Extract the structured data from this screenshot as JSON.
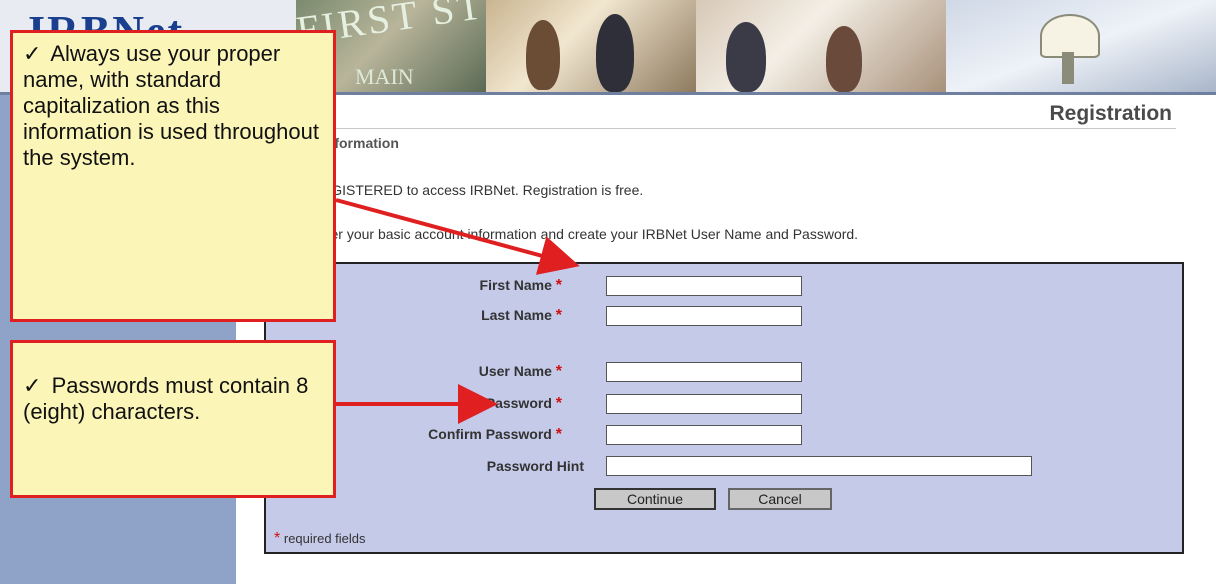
{
  "header": {
    "logo": "IRBNet",
    "street_sign": "FIRST ST",
    "street_sign_lower": "MAIN"
  },
  "page": {
    "title": "Registration",
    "section": "Account Information",
    "paragraph1": "nust be REGISTERED to access IRBNet. Registration is free.",
    "paragraph2": "ep is to enter your basic account information and create your IRBNet User Name and Password."
  },
  "form": {
    "first_name": {
      "label": "First Name",
      "value": "",
      "required": true
    },
    "last_name": {
      "label": "Last Name",
      "value": "",
      "required": true
    },
    "user_name": {
      "label": "User Name",
      "value": "",
      "required": true
    },
    "password": {
      "label": "Password",
      "value": "",
      "required": true
    },
    "confirm_password": {
      "label": "Confirm Password",
      "value": "",
      "required": true
    },
    "password_hint": {
      "label": "Password Hint",
      "value": "",
      "required": false
    },
    "required_star": "*",
    "continue_label": "Continue",
    "cancel_label": "Cancel",
    "required_note": "required fields"
  },
  "callouts": {
    "name_tip": "Always use your proper name, with standard capitalization as this information is used throughout the system.",
    "password_tip": "Passwords must contain 8 (eight) characters.",
    "check_glyph": "✓"
  },
  "colors": {
    "sidebar": "#8fa3c9",
    "form_bg": "#c5cae9",
    "callout_bg": "#fbf6b8",
    "callout_border": "#e02020",
    "required_star": "#d01010"
  }
}
